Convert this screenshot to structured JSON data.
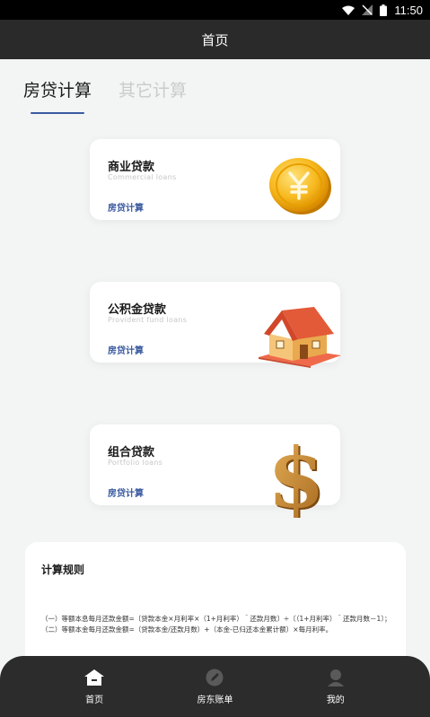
{
  "status_bar": {
    "time": "11:50",
    "icons": [
      "wifi-icon",
      "signal-off-icon",
      "battery-icon"
    ]
  },
  "header": {
    "title": "首页"
  },
  "tabs": [
    {
      "label": "房贷计算",
      "active": true
    },
    {
      "label": "其它计算",
      "active": false
    }
  ],
  "cards": [
    {
      "title": "商业贷款",
      "subtitle": "Commercial loans",
      "link": "房贷计算",
      "art": "coin-yen-icon"
    },
    {
      "title": "公积金贷款",
      "subtitle": "Provident fund loans",
      "link": "房贷计算",
      "art": "house-icon"
    },
    {
      "title": "组合贷款",
      "subtitle": "Portfolio loans",
      "link": "房贷计算",
      "art": "dollar-icon"
    }
  ],
  "rules": {
    "title": "计算规则",
    "text": "（一）等额本息每月还款金额=〔贷款本金×月利率×（1+月利率）＾还款月数〕÷〔（1+月利率）＾还款月数－1〕；（二）等额本金每月还款金额=（贷款本金/还款月数）+（本金-已归还本金累计额）×每月利率。"
  },
  "bottom_nav": [
    {
      "label": "首页",
      "icon": "home-icon"
    },
    {
      "label": "房东账单",
      "icon": "pencil-icon"
    },
    {
      "label": "我的",
      "icon": "user-icon"
    }
  ],
  "colors": {
    "accent": "#3a5aa0",
    "header_bg": "#2a2a2a",
    "page_bg": "#f3f5f5",
    "nav_bg": "#2c2c2c"
  }
}
